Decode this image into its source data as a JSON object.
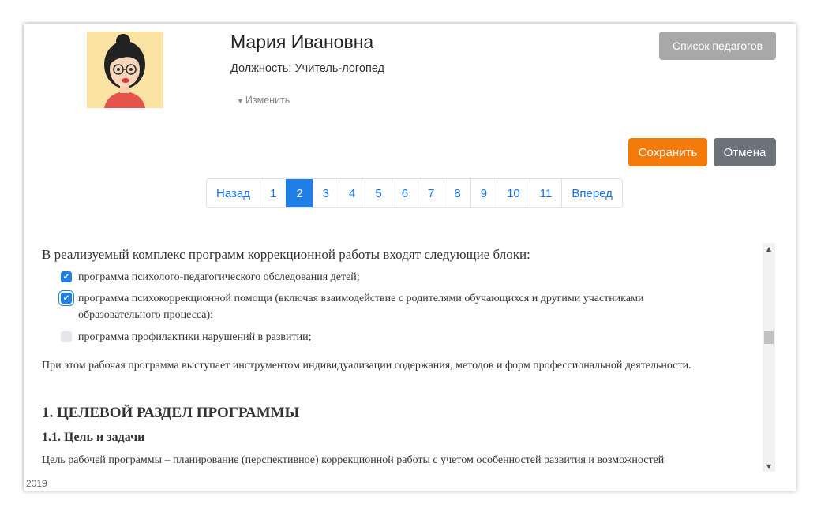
{
  "profile": {
    "name": "Мария Ивановна",
    "position_label": "Должность:",
    "position_value": "Учитель-логопед",
    "change_link": "Изменить"
  },
  "buttons": {
    "teachers_list": "Список педагогов",
    "save": "Сохранить",
    "cancel": "Отмена"
  },
  "pagination": {
    "prev": "Назад",
    "pages": [
      "1",
      "2",
      "3",
      "4",
      "5",
      "6",
      "7",
      "8",
      "9",
      "10",
      "11"
    ],
    "current": "2",
    "next": "Вперед"
  },
  "content": {
    "intro": "В реализуемый комплекс программ коррекционной работы входят следующие блоки:",
    "checklist": [
      {
        "label": "программа психолого-педагогического обследования детей;",
        "checked": true
      },
      {
        "label": "программа психокоррекционной помощи (включая взаимодействие с родителями обучающихся и другими участниками образовательного процесса);",
        "checked": true
      },
      {
        "label": "программа профилактики нарушений в развитии;",
        "checked": false
      }
    ],
    "note": "При этом рабочая программа выступает инструментом индивидуализации содержания, методов и форм профессиональной деятельности.",
    "section_title": "1. ЦЕЛЕВОЙ РАЗДЕЛ ПРОГРАММЫ",
    "subsection_title": "1.1. Цель и задачи",
    "paragraph": "Цель рабочей программы – планирование (перспективное) коррекционной работы с учетом особенностей развития и возможностей"
  },
  "footer": {
    "year": "2019"
  },
  "colors": {
    "primary": "#1f7fe6",
    "save": "#f47a0a",
    "cancel": "#6c737a",
    "teachers_button": "#a8a8a8"
  },
  "icons": [
    "avatar-image",
    "caret-down-icon",
    "check-icon",
    "scroll-up-icon",
    "scroll-down-icon"
  ]
}
